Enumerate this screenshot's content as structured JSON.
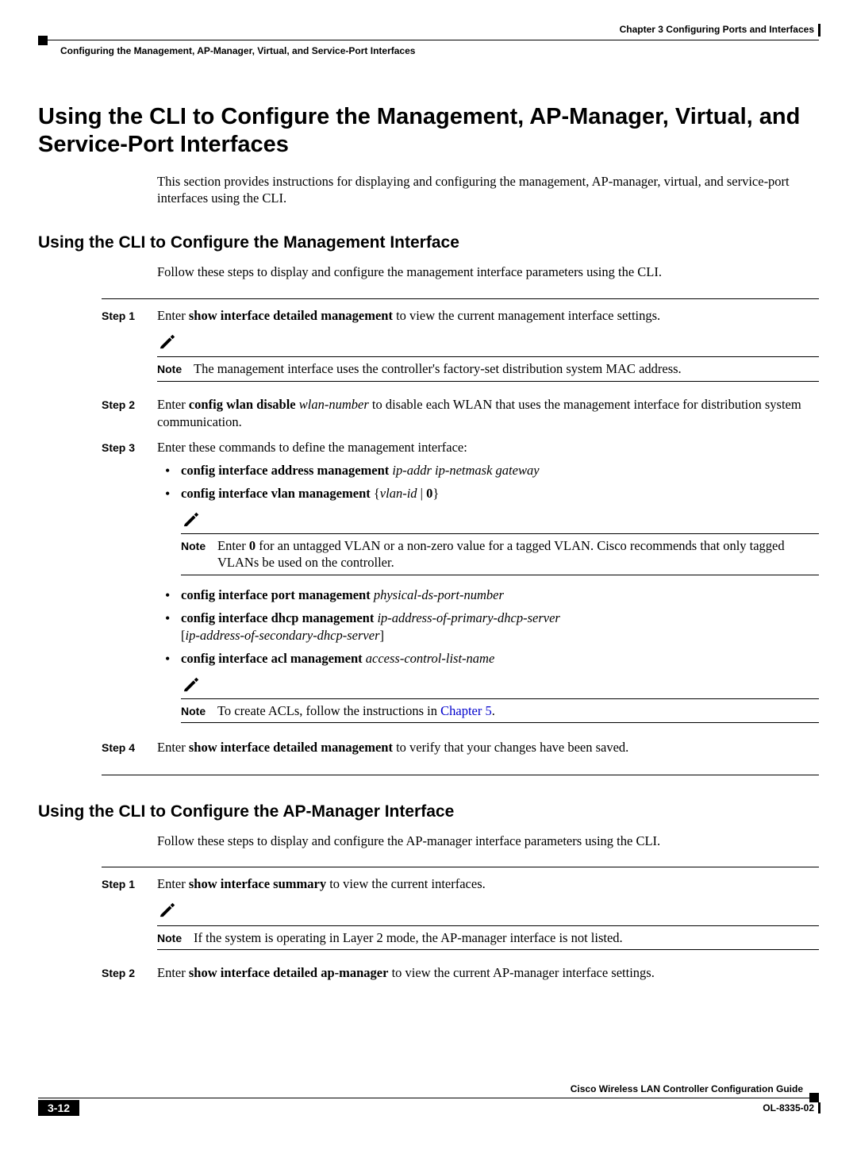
{
  "header": {
    "chapter": "Chapter 3      Configuring Ports and Interfaces",
    "section": "Configuring the Management, AP-Manager, Virtual, and Service-Port Interfaces"
  },
  "h1": "Using the CLI to Configure the Management, AP-Manager, Virtual, and Service-Port Interfaces",
  "intro": "This section provides instructions for displaying and configuring the management, AP-manager, virtual, and service-port interfaces using the CLI.",
  "sec1": {
    "title": "Using the CLI to Configure the Management Interface",
    "intro": "Follow these steps to display and configure the management interface parameters using the CLI.",
    "steps": {
      "s1": {
        "label": "Step 1",
        "pre": "Enter ",
        "cmd": "show interface detailed management",
        "post": " to view the current management interface settings.",
        "noteLabel": "Note",
        "noteText": "The management interface uses the controller's factory-set distribution system MAC address."
      },
      "s2": {
        "label": "Step 2",
        "pre": "Enter ",
        "cmd": "config wlan disable",
        "arg": " wlan-number",
        "post": " to disable each WLAN that uses the management interface for distribution system communication."
      },
      "s3": {
        "label": "Step 3",
        "intro": "Enter these commands to define the management interface:",
        "b1": {
          "cmd": "config interface address management",
          "arg": " ip-addr ip-netmask gateway"
        },
        "b2": {
          "cmd": "config interface vlan management",
          "open": " {",
          "arg": "vlan-id",
          "sep": " | ",
          "zero": "0",
          "close": "}"
        },
        "n2": {
          "label": "Note",
          "pre": "Enter ",
          "zero": "0",
          "post": " for an untagged VLAN or a non-zero value for a tagged VLAN. Cisco recommends that only tagged VLANs be used on the controller."
        },
        "b3": {
          "cmd": "config interface port management",
          "arg": " physical-ds-port-number"
        },
        "b4": {
          "cmd": "config interface dhcp management",
          "arg1": " ip-address-of-primary-dhcp-server",
          "open": "[",
          "arg2": "ip-address-of-secondary-dhcp-server",
          "close": "]"
        },
        "b5": {
          "cmd": "config interface acl management",
          "arg": " access-control-list-name"
        },
        "n5": {
          "label": "Note",
          "pre": "To create ACLs, follow the instructions in ",
          "link": "Chapter 5",
          "post": "."
        }
      },
      "s4": {
        "label": "Step 4",
        "pre": "Enter ",
        "cmd": "show interface detailed management",
        "post": " to verify that your changes have been saved."
      }
    }
  },
  "sec2": {
    "title": "Using the CLI to Configure the AP-Manager Interface",
    "intro": "Follow these steps to display and configure the AP-manager interface parameters using the CLI.",
    "steps": {
      "s1": {
        "label": "Step 1",
        "pre": "Enter ",
        "cmd": "show interface summary",
        "post": " to view the current interfaces.",
        "noteLabel": "Note",
        "noteText": "If the system is operating in Layer 2 mode, the AP-manager interface is not listed."
      },
      "s2": {
        "label": "Step 2",
        "pre": "Enter ",
        "cmd": "show interface detailed ap-manager",
        "post": " to view the current AP-manager interface settings."
      }
    }
  },
  "footer": {
    "guide": "Cisco Wireless LAN Controller Configuration Guide",
    "doc": "OL-8335-02",
    "page": "3-12"
  }
}
